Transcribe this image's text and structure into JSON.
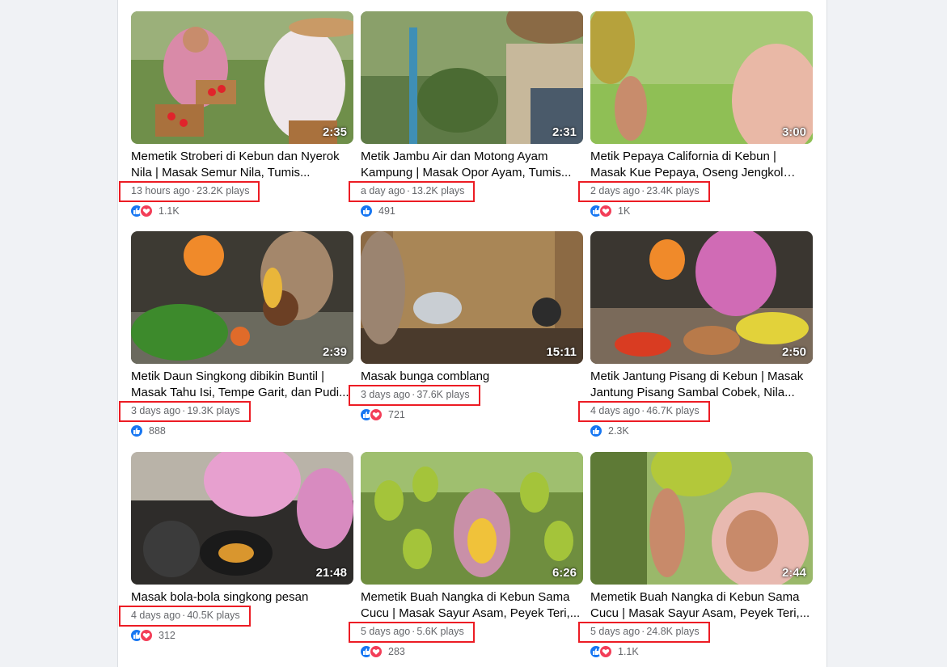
{
  "videos": [
    {
      "duration": "2:35",
      "title": "Memetik Stroberi di Kebun dan Nyerok Nila | Masak Semur Nila, Tumis...",
      "age": "13 hours ago",
      "plays": "23.2K plays",
      "reactions": "1.1K",
      "has_love": true
    },
    {
      "duration": "2:31",
      "title": "Metik Jambu Air dan Motong Ayam Kampung | Masak Opor Ayam, Tumis...",
      "age": "a day ago",
      "plays": "13.2K plays",
      "reactions": "491",
      "has_love": false
    },
    {
      "duration": "3:00",
      "title": "Metik Pepaya California di Kebun | Masak Kue Pepaya, Oseng Jengkol Plu...",
      "age": "2 days ago",
      "plays": "23.4K plays",
      "reactions": "1K",
      "has_love": true
    },
    {
      "duration": "2:39",
      "title": "Metik Daun Singkong dibikin Buntil | Masak Tahu Isi, Tempe Garit, dan Pudi...",
      "age": "3 days ago",
      "plays": "19.3K plays",
      "reactions": "888",
      "has_love": false
    },
    {
      "duration": "15:11",
      "title": "Masak bunga comblang",
      "age": "3 days ago",
      "plays": "37.6K plays",
      "reactions": "721",
      "has_love": true
    },
    {
      "duration": "2:50",
      "title": "Metik Jantung Pisang di Kebun | Masak Jantung Pisang Sambal Cobek, Nila...",
      "age": "4 days ago",
      "plays": "46.7K plays",
      "reactions": "2.3K",
      "has_love": false
    },
    {
      "duration": "21:48",
      "title": "Masak bola-bola singkong pesan",
      "age": "4 days ago",
      "plays": "40.5K plays",
      "reactions": "312",
      "has_love": true
    },
    {
      "duration": "6:26",
      "title": "Memetik Buah Nangka di Kebun Sama Cucu | Masak Sayur Asam, Peyek Teri,...",
      "age": "5 days ago",
      "plays": "5.6K plays",
      "reactions": "283",
      "has_love": true
    },
    {
      "duration": "2:44",
      "title": "Memetik Buah Nangka di Kebun Sama Cucu | Masak Sayur Asam, Peyek Teri,...",
      "age": "5 days ago",
      "plays": "24.8K plays",
      "reactions": "1.1K",
      "has_love": true
    }
  ],
  "meta_separator": "·",
  "colors": {
    "like": "#1877f2",
    "love": "#f33e58",
    "highlight": "#ec1c24"
  }
}
